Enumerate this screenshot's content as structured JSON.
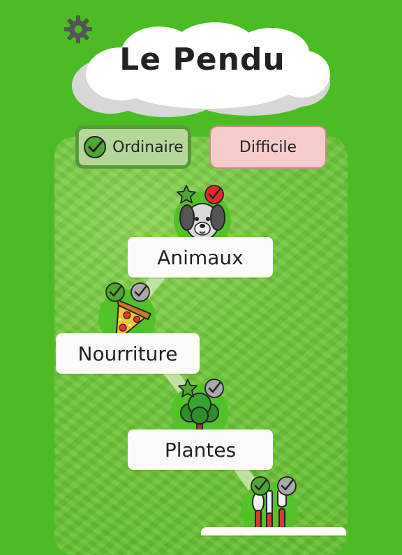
{
  "app": {
    "title": "Le Pendu"
  },
  "modes": {
    "ordinary": "Ordinaire",
    "difficult": "Difficile",
    "selected": "ordinary"
  },
  "categories": [
    {
      "label": "Animaux",
      "icon": "dog-icon",
      "badges": [
        "star-icon",
        "check-red-icon"
      ]
    },
    {
      "label": "Nourriture",
      "icon": "pizza-icon",
      "badges": [
        "check-green-icon",
        "check-gray-icon"
      ]
    },
    {
      "label": "Plantes",
      "icon": "tree-icon",
      "badges": [
        "star-icon",
        "check-gray-icon"
      ]
    },
    {
      "label": "",
      "icon": "cutlery-icon",
      "badges": [
        "check-green-icon",
        "check-gray-icon"
      ]
    }
  ],
  "colors": {
    "background": "#4cbc24",
    "star": "#4ca832",
    "check_green": "#4ca832",
    "check_red": "#e8262b",
    "check_gray": "#a9a9a9"
  }
}
